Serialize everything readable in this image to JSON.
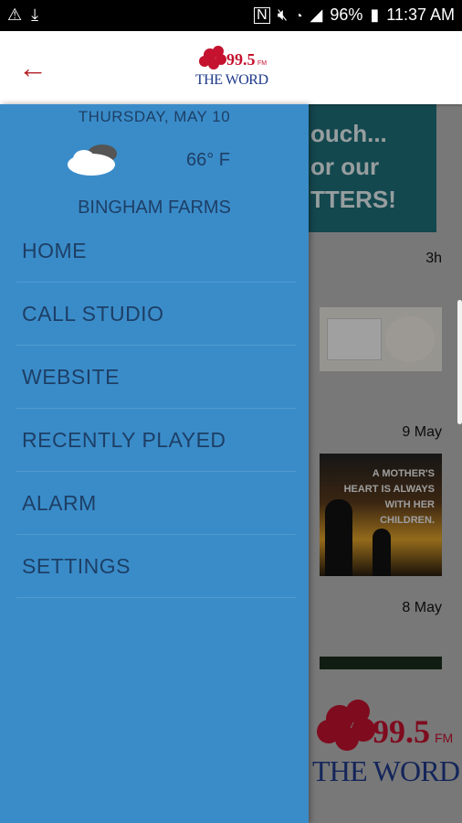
{
  "status_bar": {
    "battery": "96%",
    "time": "11:37 AM"
  },
  "app_bar": {
    "logo_number": "99.5",
    "logo_fm": "FM",
    "logo_name": "THE WORD"
  },
  "drawer": {
    "date": "THURSDAY, MAY 10",
    "temperature": "66° F",
    "location": "BINGHAM FARMS",
    "menu": [
      {
        "label": "HOME"
      },
      {
        "label": "CALL STUDIO"
      },
      {
        "label": "WEBSITE"
      },
      {
        "label": "RECENTLY PLAYED"
      },
      {
        "label": "ALARM"
      },
      {
        "label": "SETTINGS"
      }
    ]
  },
  "background_feed": {
    "banner_lines": [
      "ouch...",
      "or our",
      "TTERS!"
    ],
    "posts": [
      {
        "time": "3h"
      },
      {
        "time": "9 May",
        "image_text": "A MOTHER'S HEART IS ALWAYS WITH HER CHILDREN."
      },
      {
        "time": "8 May"
      }
    ],
    "footer_logo": {
      "number": "99.5",
      "fm": "FM",
      "name": "THE WORD"
    }
  },
  "colors": {
    "drawer": "#3a8cc9",
    "brand_red": "#b32025",
    "text_dark": "#1d3f66"
  }
}
